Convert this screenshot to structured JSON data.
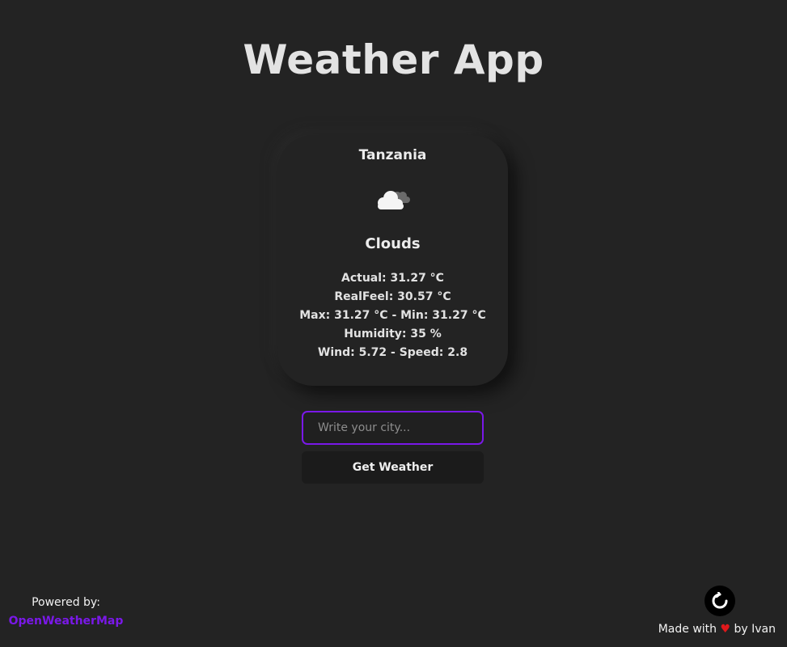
{
  "app": {
    "title": "Weather App"
  },
  "weather": {
    "country": "Tanzania",
    "icon": "clouds-icon",
    "condition": "Clouds",
    "actual": "Actual: 31.27 °C",
    "realfeel": "RealFeel: 30.57 °C",
    "max_min": "Max: 31.27 °C - Min: 31.27 °C",
    "humidity": "Humidity: 35 %",
    "wind": "Wind: 5.72 - Speed: 2.8"
  },
  "search": {
    "placeholder": "Write your city...",
    "value": "",
    "button_label": "Get Weather"
  },
  "footer": {
    "powered_label": "Powered by:",
    "provider_link": "OpenWeatherMap",
    "made_with_prefix": "Made with",
    "heart": "♥",
    "made_with_suffix": "by Ivan",
    "github_icon": "github-icon"
  },
  "colors": {
    "background": "#232323",
    "accent": "#7a18e8",
    "heart": "#e0181b"
  }
}
